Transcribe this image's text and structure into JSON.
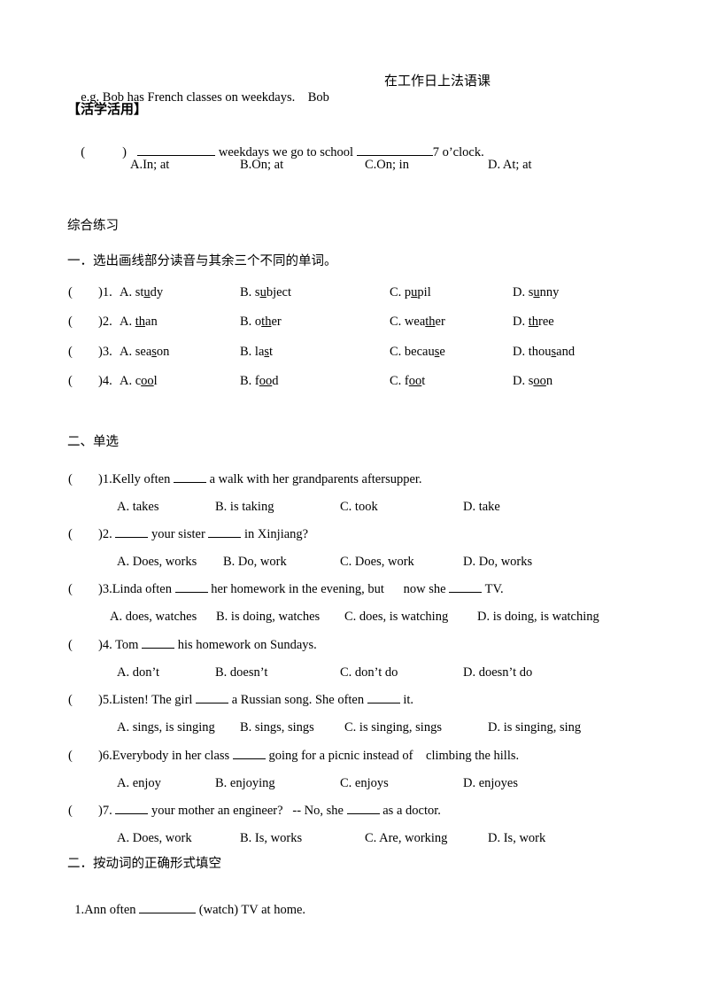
{
  "example": {
    "en": "e.g. Bob has French classes on weekdays.",
    "name": "Bob",
    "cn": "在工作日上法语课"
  },
  "practice": {
    "heading": "【活学活用】",
    "question": {
      "paren_open": "(",
      "paren_close": ")",
      "part1": "weekdays we go to school",
      "part2": "7 o’clock."
    },
    "options": [
      "A.In; at",
      "B.On; at",
      "C.On; in",
      "D. At; at"
    ]
  },
  "comprehensive": {
    "title": "综合练习"
  },
  "section1": {
    "title": "一．选出画线部分读音与其余三个不同的单词。",
    "items": [
      {
        "num": ")1. ",
        "options": [
          {
            "label": "A. ",
            "pre": "st",
            "u": "u",
            "post": "dy"
          },
          {
            "label": "B. ",
            "pre": "s",
            "u": "u",
            "post": "bject"
          },
          {
            "label": "C. ",
            "pre": "p",
            "u": "u",
            "post": "pil"
          },
          {
            "label": "D. ",
            "pre": "s",
            "u": "u",
            "post": "nny"
          }
        ]
      },
      {
        "num": ")2. ",
        "options": [
          {
            "label": "A. ",
            "pre": "",
            "u": "th",
            "post": "an"
          },
          {
            "label": "B. ",
            "pre": "o",
            "u": "th",
            "post": "er"
          },
          {
            "label": "C. ",
            "pre": "wea",
            "u": "th",
            "post": "er"
          },
          {
            "label": "D. ",
            "pre": "",
            "u": "th",
            "post": "ree"
          }
        ]
      },
      {
        "num": ")3. ",
        "options": [
          {
            "label": "A. ",
            "pre": "sea",
            "u": "s",
            "post": "on"
          },
          {
            "label": "B. ",
            "pre": "la",
            "u": "s",
            "post": "t"
          },
          {
            "label": "C. ",
            "pre": "becau",
            "u": "s",
            "post": "e"
          },
          {
            "label": "D. ",
            "pre": "thou",
            "u": "s",
            "post": "and"
          }
        ]
      },
      {
        "num": ")4. ",
        "options": [
          {
            "label": "A. ",
            "pre": "c",
            "u": "oo",
            "post": "l"
          },
          {
            "label": "B. ",
            "pre": "f",
            "u": "oo",
            "post": "d"
          },
          {
            "label": "C. ",
            "pre": "f",
            "u": "oo",
            "post": "t"
          },
          {
            "label": "D. ",
            "pre": "s",
            "u": "oo",
            "post": "n"
          }
        ]
      }
    ]
  },
  "section2": {
    "title": "二、单选",
    "items": [
      {
        "q": [
          ")1.Kelly often ",
          "BLANK",
          " a walk with her grandparents aftersupper."
        ],
        "options": [
          "A. takes",
          "B. is taking",
          "C. took",
          "D. take"
        ]
      },
      {
        "q": [
          ")2. ",
          "BLANK",
          " your sister ",
          "BLANK",
          " in Xinjiang?"
        ],
        "options": [
          "A. Does, works",
          "B. Do, work",
          "C. Does, work",
          "D. Do, works"
        ]
      },
      {
        "q": [
          ")3.Linda often ",
          "BLANK",
          " her homework in the evening, but      now she ",
          "BLANK",
          " TV."
        ],
        "options": [
          "A. does, watches",
          "B. is doing, watches",
          "C. does, is watching",
          "D. is doing, is watching"
        ]
      },
      {
        "q": [
          ")4. Tom ",
          "BLANK",
          " his homework on Sundays."
        ],
        "options": [
          "A. don’t",
          "B. doesn’t",
          "C. don’t do",
          "D. doesn’t do"
        ]
      },
      {
        "q": [
          ")5.Listen! The girl ",
          "BLANK",
          " a Russian song. She often ",
          "BLANK",
          " it."
        ],
        "options": [
          "A. sings, is singing",
          "B. sings, sings",
          "C. is singing, sings",
          "D. is singing, sing"
        ]
      },
      {
        "q": [
          ")6.Everybody in her class ",
          "BLANK",
          " going for a picnic instead of    climbing the hills."
        ],
        "options": [
          "A. enjoy",
          "B. enjoying",
          "C. enjoys",
          "D. enjoyes"
        ]
      },
      {
        "q": [
          ")7. ",
          "BLANK",
          " your mother an engineer?   -- No, she ",
          "BLANK",
          " as a doctor."
        ],
        "options": [
          "A. Does, work",
          "B. Is, works",
          "C. Are, working",
          "D. Is, work"
        ]
      }
    ]
  },
  "section3": {
    "title": "二．按动词的正确形式填空",
    "items": [
      {
        "pre": "1.Ann often ",
        "post": " (watch) TV at home."
      }
    ]
  }
}
